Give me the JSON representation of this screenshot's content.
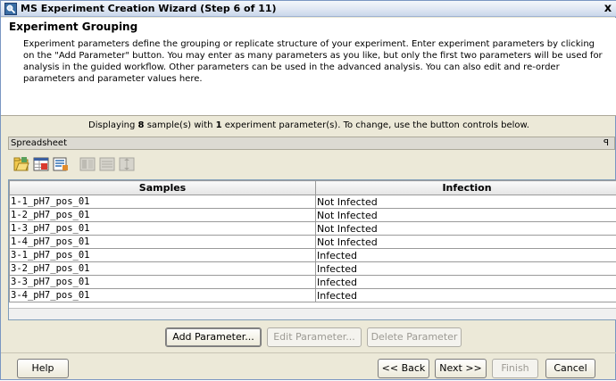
{
  "window": {
    "title": "MS Experiment Creation Wizard (Step 6 of 11)",
    "close_label": "x"
  },
  "header": {
    "title": "Experiment Grouping",
    "description": "Experiment parameters define the grouping or replicate structure of your experiment. Enter experiment parameters by clicking on the \"Add Parameter\" button. You may enter as many parameters as you like, but only the first two parameters will be used for analysis in the guided workflow. Other parameters can be used in the advanced analysis. You can also edit and re-order parameters and parameter values here."
  },
  "info": {
    "prefix": "Displaying ",
    "sample_count": "8",
    "middle": " sample(s) with ",
    "param_count": "1",
    "suffix": " experiment parameter(s). To change, use the button controls below."
  },
  "spreadsheet": {
    "panel_title": "Spreadsheet",
    "pin_icon": "pin-icon",
    "columns": [
      "Samples",
      "Infection"
    ],
    "rows": [
      [
        "1-1_pH7_pos_01",
        "Not Infected"
      ],
      [
        "1-2_pH7_pos_01",
        "Not Infected"
      ],
      [
        "1-3_pH7_pos_01",
        "Not Infected"
      ],
      [
        "1-4_pH7_pos_01",
        "Not Infected"
      ],
      [
        "3-1_pH7_pos_01",
        "Infected"
      ],
      [
        "3-2_pH7_pos_01",
        "Infected"
      ],
      [
        "3-3_pH7_pos_01",
        "Infected"
      ],
      [
        "3-4_pH7_pos_01",
        "Infected"
      ]
    ]
  },
  "toolbar": {
    "icons": [
      "open-file-icon",
      "import-icon",
      "sample-attributes-icon",
      "group-icon-disabled",
      "sort-icon-disabled",
      "reorder-icon-disabled"
    ]
  },
  "param_buttons": {
    "add": "Add Parameter...",
    "edit": "Edit Parameter...",
    "delete": "Delete Parameter"
  },
  "nav": {
    "help": "Help",
    "back": "<< Back",
    "next": "Next >>",
    "finish": "Finish",
    "cancel": "Cancel"
  },
  "colors": {
    "window_bg": "#ece9d8",
    "title_gradient_top": "#f4f7fb",
    "title_gradient_bottom": "#c9d6ea"
  }
}
